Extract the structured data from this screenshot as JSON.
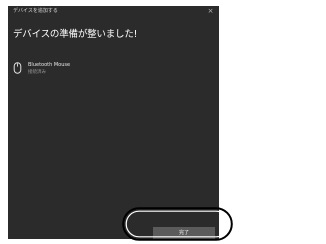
{
  "dialog": {
    "title": "デバイスを追加する",
    "close_glyph": "×",
    "heading": "デバイスの準備が整いました!",
    "device": {
      "icon": "mouse-icon",
      "name": "Bluetooth Mouse",
      "status": "接続済み"
    },
    "done_label": "完了"
  },
  "colors": {
    "dialog_bg": "#2b2b2b",
    "button_bg": "#5b5b5b",
    "annotation_ring": "#000000"
  }
}
